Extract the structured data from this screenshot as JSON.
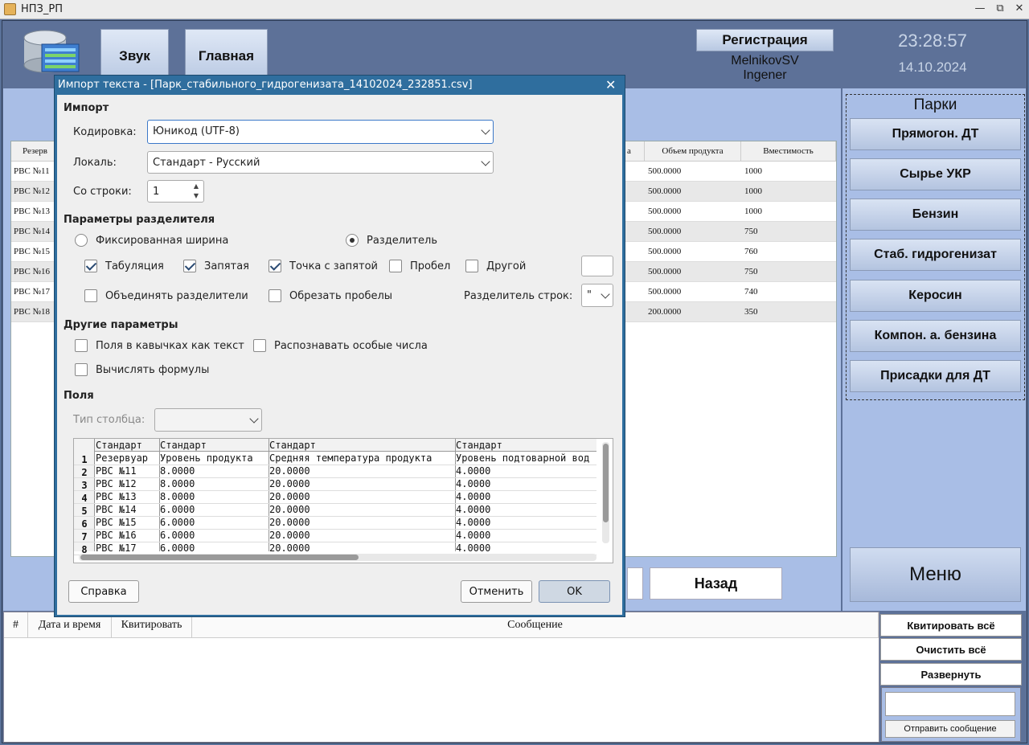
{
  "window": {
    "title": "НПЗ_РП",
    "min": "—",
    "max": "⧉",
    "close": "✕"
  },
  "header": {
    "tabs": [
      {
        "label": "Звук"
      },
      {
        "label": "Главная"
      }
    ],
    "register_label": "Регистрация",
    "user": "MelnikovSV",
    "role": "Ingener",
    "time": "23:28:57",
    "date": "14.10.2024"
  },
  "table": {
    "headers": [
      "Резерв",
      "а",
      "Объем продукта",
      "Вместимость"
    ],
    "rows": [
      {
        "name": "РВС №11",
        "volume": "500.0000",
        "capacity": "1000"
      },
      {
        "name": "РВС №12",
        "volume": "500.0000",
        "capacity": "1000"
      },
      {
        "name": "РВС №13",
        "volume": "500.0000",
        "capacity": "1000"
      },
      {
        "name": "РВС №14",
        "volume": "500.0000",
        "capacity": "750"
      },
      {
        "name": "РВС №15",
        "volume": "500.0000",
        "capacity": "760"
      },
      {
        "name": "РВС №16",
        "volume": "500.0000",
        "capacity": "750"
      },
      {
        "name": "РВС №17",
        "volume": "500.0000",
        "capacity": "740"
      },
      {
        "name": "РВС №18",
        "volume": "200.0000",
        "capacity": "350"
      }
    ]
  },
  "nav": {
    "back_label": "Назад"
  },
  "parks": {
    "title": "Парки",
    "items": [
      "Прямогон. ДТ",
      "Сырье УКР",
      "Бензин",
      "Стаб. гидрогенизат",
      "Керосин",
      "Компон. а. бензина",
      "Присадки для ДТ"
    ],
    "menu_label": "Меню"
  },
  "messages": {
    "headers": [
      "#",
      "Дата и время",
      "Квитировать",
      "Сообщение"
    ],
    "ack_all": "Квитировать всё",
    "clear_all": "Очистить всё",
    "expand": "Развернуть",
    "send_label": "Отправить сообщение",
    "send_input_value": ""
  },
  "dialog": {
    "title": "Импорт текста - [Парк_стабильного_гидрогенизата_14102024_232851.csv]",
    "import_section": "Импорт",
    "encoding_label": "Кодировка:",
    "encoding_value": "Юникод (UTF-8)",
    "locale_label": "Локаль:",
    "locale_value": "Стандарт - Русский",
    "from_row_label": "Со строки:",
    "from_row_value": "1",
    "sep_section": "Параметры разделителя",
    "fixed_width": "Фиксированная ширина",
    "separated": "Разделитель",
    "tab": "Табуляция",
    "comma": "Запятая",
    "semicolon": "Точка с запятой",
    "space": "Пробел",
    "other": "Другой",
    "merge": "Объединять разделители",
    "trim": "Обрезать пробелы",
    "string_delim_label": "Разделитель строк:",
    "string_delim_value": "\"",
    "other_section": "Другие параметры",
    "quoted_as_text": "Поля в кавычках как текст",
    "detect_special": "Распознавать особые числа",
    "eval_formulas": "Вычислять формулы",
    "fields_section": "Поля",
    "col_type_label": "Тип столбца:",
    "col_type_value": "",
    "preview_types": [
      "Стандарт",
      "Стандарт",
      "Стандарт",
      "Стандарт"
    ],
    "preview_rows": [
      [
        "1",
        "Резервуар",
        "Уровень продукта",
        "Средняя температура продукта",
        "Уровень подтоварной вод"
      ],
      [
        "2",
        "РВС №11",
        "8.0000",
        "20.0000",
        "4.0000"
      ],
      [
        "3",
        "РВС №12",
        "8.0000",
        "20.0000",
        "4.0000"
      ],
      [
        "4",
        "РВС №13",
        "8.0000",
        "20.0000",
        "4.0000"
      ],
      [
        "5",
        "РВС №14",
        "6.0000",
        "20.0000",
        "4.0000"
      ],
      [
        "6",
        "РВС №15",
        "6.0000",
        "20.0000",
        "4.0000"
      ],
      [
        "7",
        "РВС №16",
        "6.0000",
        "20.0000",
        "4.0000"
      ],
      [
        "8",
        "РВС №17",
        "6.0000",
        "20.0000",
        "4.0000"
      ]
    ],
    "help": "Справка",
    "cancel": "Отменить",
    "ok": "OK",
    "close": "✕"
  }
}
